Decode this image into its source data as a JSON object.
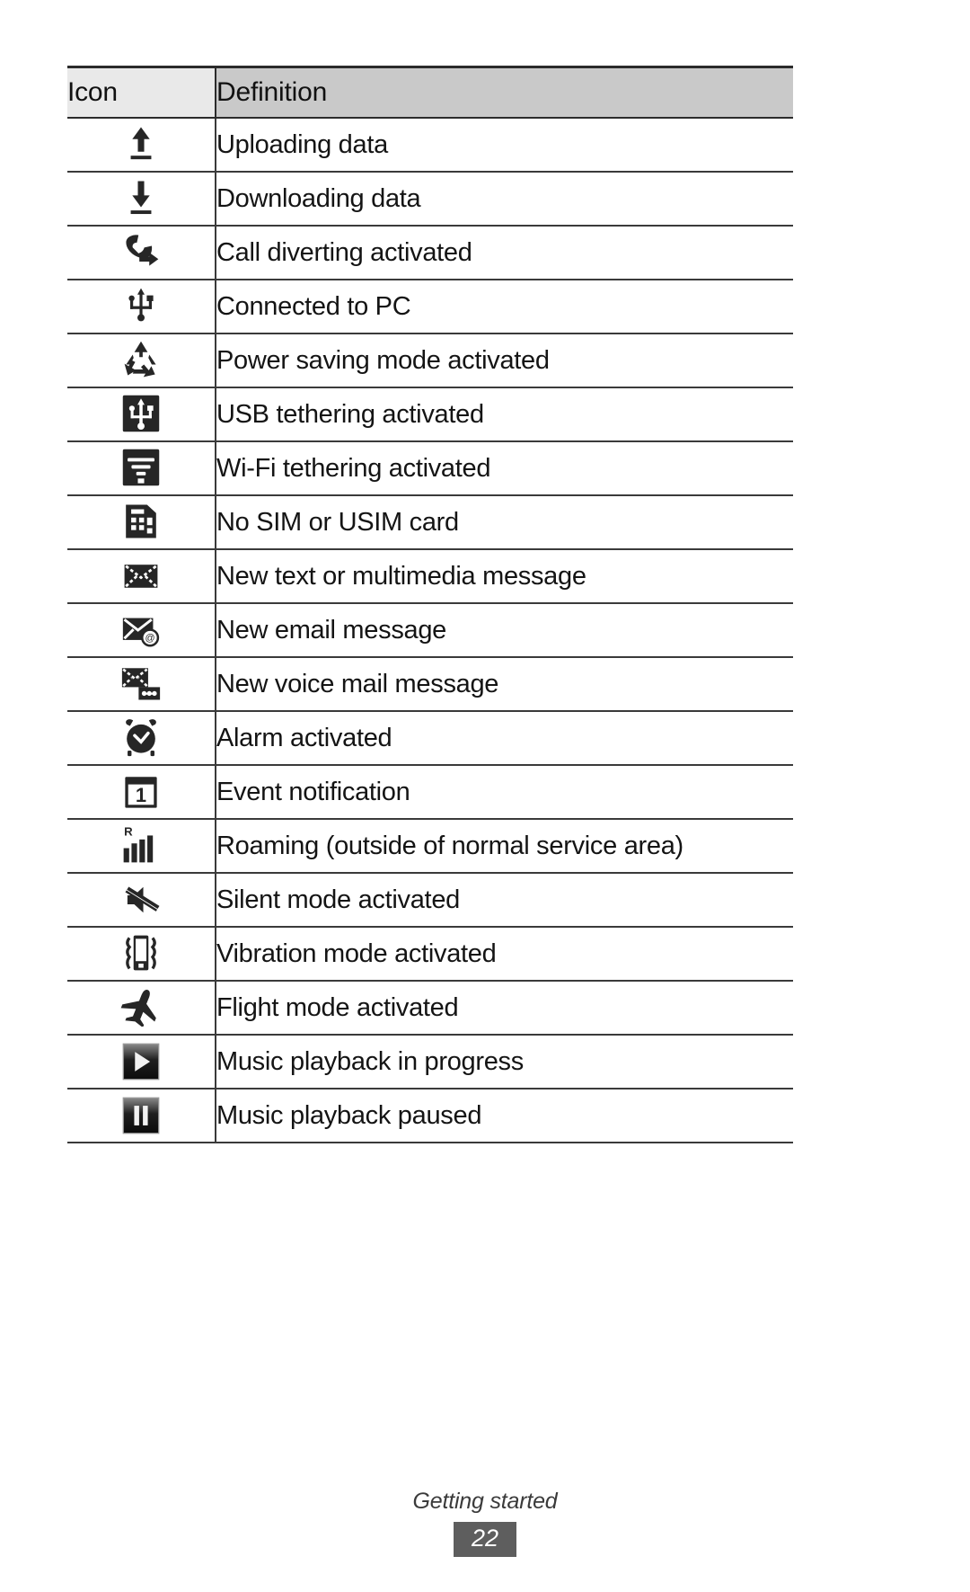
{
  "table": {
    "headers": {
      "icon": "Icon",
      "definition": "Definition"
    },
    "header_colors": {
      "icon_bg": "#e9e9e9",
      "definition_bg": "#c9c9c9",
      "rule": "#2b2b2b"
    },
    "rows": [
      {
        "icon": "upload-arrow-icon",
        "definition": "Uploading data"
      },
      {
        "icon": "download-arrow-icon",
        "definition": "Downloading data"
      },
      {
        "icon": "call-diverting-icon",
        "definition": "Call diverting activated"
      },
      {
        "icon": "usb-connected-icon",
        "definition": "Connected to PC"
      },
      {
        "icon": "recycle-power-saving-icon",
        "definition": "Power saving mode activated"
      },
      {
        "icon": "usb-tethering-icon",
        "definition": "USB tethering activated"
      },
      {
        "icon": "wifi-tethering-icon",
        "definition": "Wi-Fi tethering activated"
      },
      {
        "icon": "no-sim-card-icon",
        "definition": "No SIM or USIM card"
      },
      {
        "icon": "new-message-icon",
        "definition": "New text or multimedia message"
      },
      {
        "icon": "new-email-icon",
        "definition": "New email message"
      },
      {
        "icon": "new-voicemail-icon",
        "definition": "New voice mail message"
      },
      {
        "icon": "alarm-clock-icon",
        "definition": "Alarm activated"
      },
      {
        "icon": "calendar-event-icon",
        "definition": "Event notification"
      },
      {
        "icon": "roaming-signal-icon",
        "definition": "Roaming (outside of normal service area)"
      },
      {
        "icon": "silent-mute-icon",
        "definition": "Silent mode activated"
      },
      {
        "icon": "vibration-mode-icon",
        "definition": "Vibration mode activated"
      },
      {
        "icon": "flight-mode-icon",
        "definition": "Flight mode activated"
      },
      {
        "icon": "music-play-icon",
        "definition": "Music playback in progress"
      },
      {
        "icon": "music-pause-icon",
        "definition": "Music playback paused"
      }
    ]
  },
  "footer": {
    "section_title": "Getting started",
    "page_number": "22",
    "page_badge_bg": "#5e5e5e"
  }
}
